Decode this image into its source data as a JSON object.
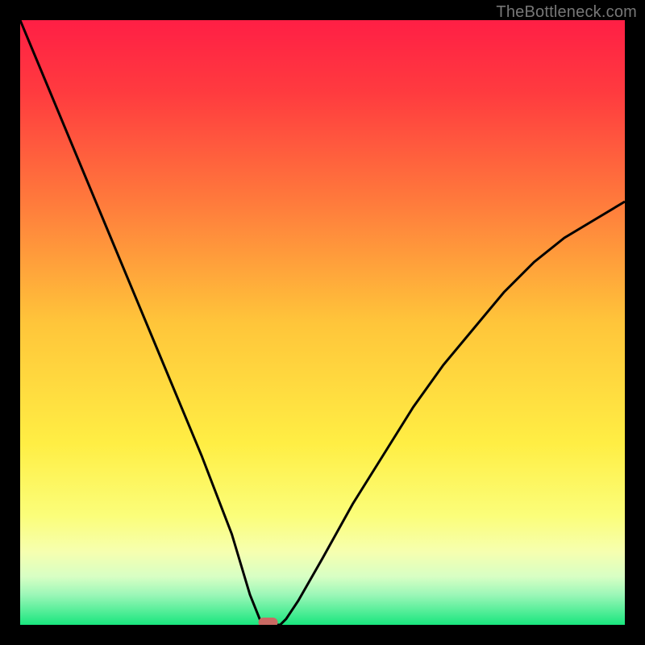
{
  "watermark": "TheBottleneck.com",
  "chart_data": {
    "type": "line",
    "title": "",
    "xlabel": "",
    "ylabel": "",
    "xlim": [
      0,
      100
    ],
    "ylim": [
      0,
      100
    ],
    "x": [
      0,
      5,
      10,
      15,
      20,
      25,
      30,
      35,
      38,
      40,
      41,
      42,
      43,
      44,
      46,
      50,
      55,
      60,
      65,
      70,
      75,
      80,
      85,
      90,
      95,
      100
    ],
    "values": [
      100,
      88,
      76,
      64,
      52,
      40,
      28,
      15,
      5,
      0,
      0,
      0,
      0,
      1,
      4,
      11,
      20,
      28,
      36,
      43,
      49,
      55,
      60,
      64,
      67,
      70
    ],
    "marker": {
      "x": 41,
      "y": 0,
      "shape": "pill",
      "color": "#c96a63"
    },
    "gradient_stops": [
      {
        "offset": 0.0,
        "color": "#ff1f45"
      },
      {
        "offset": 0.12,
        "color": "#ff3b3f"
      },
      {
        "offset": 0.3,
        "color": "#ff7a3c"
      },
      {
        "offset": 0.5,
        "color": "#ffc53a"
      },
      {
        "offset": 0.7,
        "color": "#ffee44"
      },
      {
        "offset": 0.82,
        "color": "#fbfe7a"
      },
      {
        "offset": 0.88,
        "color": "#f6ffb0"
      },
      {
        "offset": 0.92,
        "color": "#d8ffc4"
      },
      {
        "offset": 0.95,
        "color": "#9cf7b8"
      },
      {
        "offset": 1.0,
        "color": "#19e67e"
      }
    ]
  }
}
